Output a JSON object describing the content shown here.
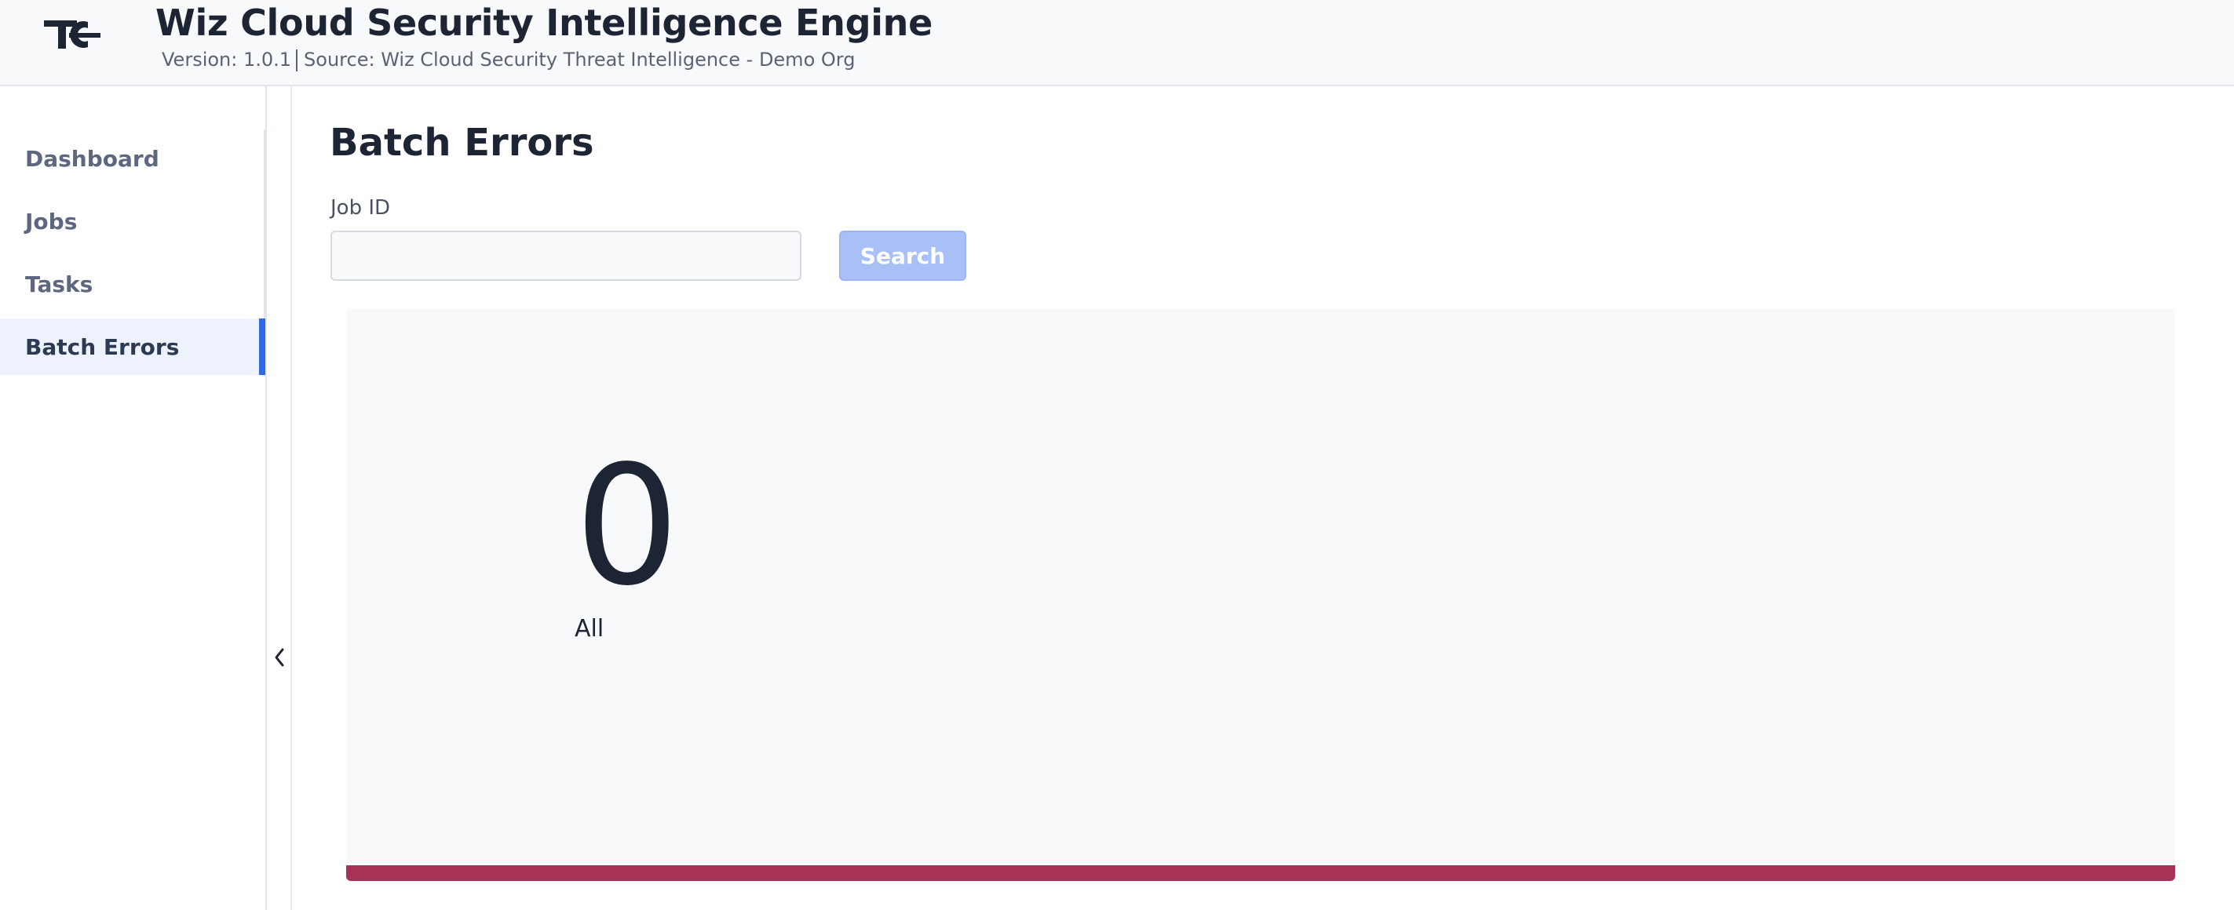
{
  "header": {
    "title": "Wiz Cloud Security Intelligence Engine",
    "version": "Version: 1.0.1",
    "source": "Source: Wiz Cloud Security Threat Intelligence - Demo Org",
    "logo_icon": "tc-logo-icon"
  },
  "sidebar": {
    "items": [
      {
        "label": "Dashboard",
        "active": false
      },
      {
        "label": "Jobs",
        "active": false
      },
      {
        "label": "Tasks",
        "active": false
      },
      {
        "label": "Batch Errors",
        "active": true
      }
    ],
    "collapse_icon": "chevron-left-icon"
  },
  "main": {
    "title": "Batch Errors",
    "job_id_label": "Job ID",
    "job_id_value": "",
    "job_id_placeholder": "",
    "search_label": "Search"
  },
  "stat": {
    "value": "0",
    "label": "All",
    "accent_color": "#a83255"
  },
  "colors": {
    "accent": "#2f67e6",
    "button_disabled": "#a9c0f6",
    "status_bar": "#a83255"
  }
}
